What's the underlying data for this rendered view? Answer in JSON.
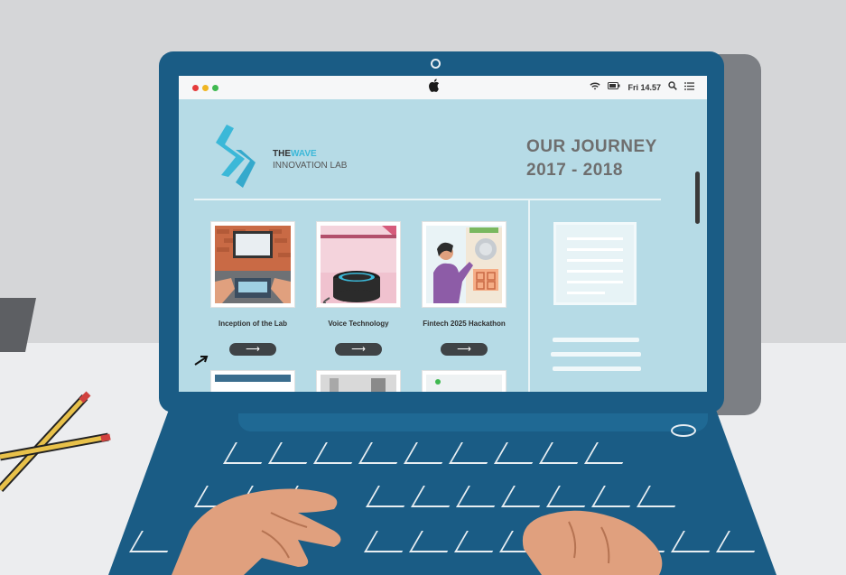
{
  "menubar": {
    "clock": "Fri 14.57",
    "traffic_colors": [
      "#e53b3b",
      "#f0b623",
      "#3fb950"
    ]
  },
  "brand": {
    "the": "THE",
    "wave": "WAVE",
    "sub": "INNOVATION LAB"
  },
  "journey": {
    "title": "OUR JOURNEY",
    "years": "2017 - 2018"
  },
  "cards": [
    {
      "label": "Inception of the Lab",
      "button": "⟶"
    },
    {
      "label": "Voice Technology",
      "button": "⟶"
    },
    {
      "label": "Fintech 2025 Hackathon",
      "button": "⟶"
    }
  ],
  "icons": {
    "apple": "apple-icon",
    "wifi": "wifi-icon",
    "battery": "battery-icon",
    "search": "search-icon",
    "menu": "menu-list-icon"
  },
  "colors": {
    "laptop": "#1a5c85",
    "screen_bg": "#b6dbe6",
    "accent": "#3bb8d8"
  }
}
